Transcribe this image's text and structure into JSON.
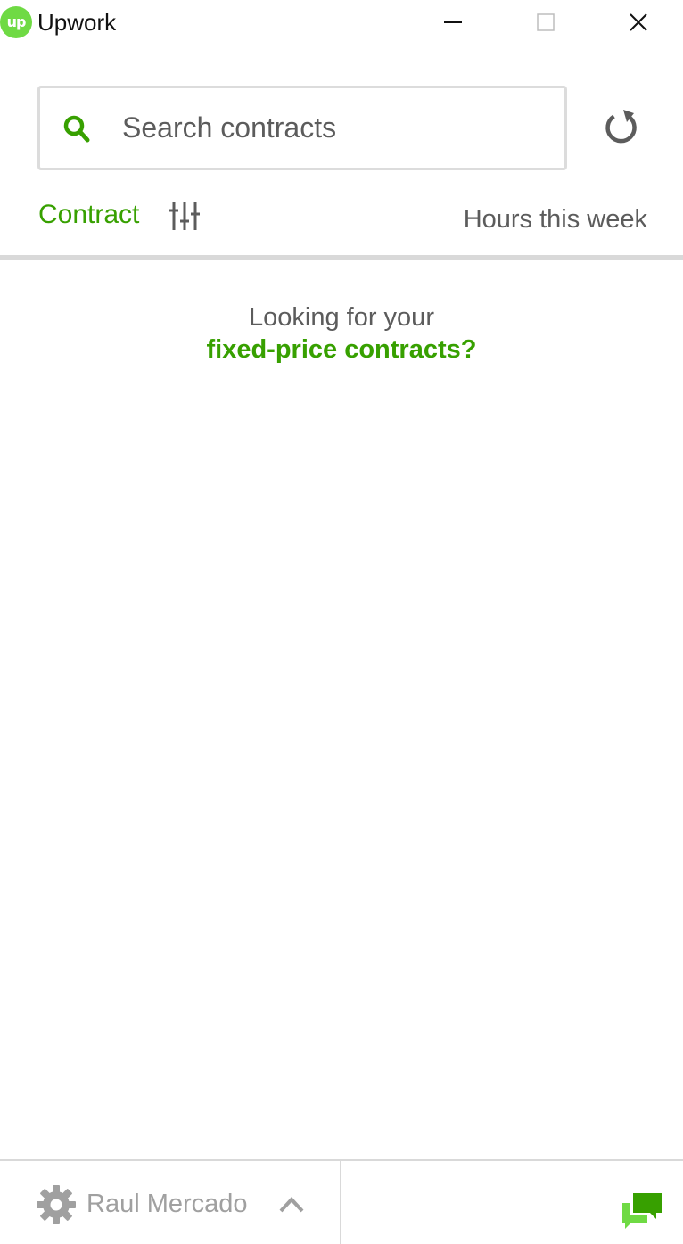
{
  "app": {
    "title": "Upwork",
    "logo_text": "up",
    "logo_color": "#6fda44"
  },
  "window_controls": {
    "minimize_icon": "minimize-icon",
    "maximize_icon": "maximize-icon",
    "close_icon": "close-icon"
  },
  "search": {
    "placeholder": "Search contracts",
    "value": "",
    "icon": "search-icon"
  },
  "toolbar": {
    "refresh_icon": "refresh-icon"
  },
  "columns": {
    "contract_label": "Contract",
    "filter_icon": "sliders-filter-icon",
    "hours_label": "Hours this week"
  },
  "empty_state": {
    "line1": "Looking for your",
    "link_text": "fixed-price contracts?"
  },
  "footer": {
    "settings_icon": "gear-icon",
    "user_name": "Raul Mercado",
    "expand_icon": "chevron-up-icon",
    "messages_icon": "chat-bubbles-icon"
  },
  "colors": {
    "accent": "#37a000",
    "brand_green": "#6fda44",
    "text": "#5c5c5c",
    "muted": "#a0a0a0",
    "divider": "#d9d9d9"
  }
}
